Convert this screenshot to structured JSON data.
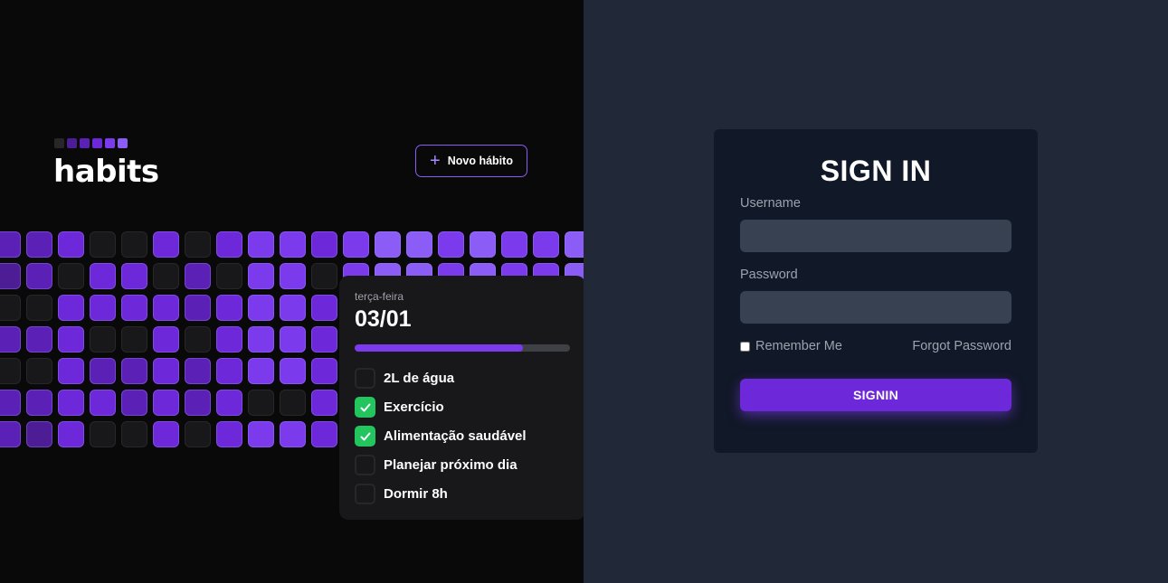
{
  "app": {
    "name": "habits",
    "new_habit_label": "Novo hábito"
  },
  "colors": {
    "accent": "#7c3aed",
    "success": "#22c55e",
    "cell_levels": [
      "#18181b",
      "#4c1d95",
      "#5b21b6",
      "#6d28d9",
      "#7c3aed",
      "#8b5cf6"
    ]
  },
  "heatmap_levels": [
    [
      2,
      2,
      3,
      0,
      0,
      3,
      0,
      3,
      4,
      4,
      3,
      4,
      5,
      5,
      4,
      5,
      4,
      4,
      5
    ],
    [
      1,
      2,
      0,
      3,
      3,
      0,
      2,
      0,
      4,
      4,
      0,
      4,
      5,
      5,
      4,
      5,
      4,
      4,
      5
    ],
    [
      0,
      0,
      3,
      3,
      3,
      3,
      2,
      3,
      4,
      4,
      3,
      4,
      5,
      4,
      4,
      5,
      4,
      4,
      5
    ],
    [
      2,
      2,
      3,
      0,
      0,
      3,
      0,
      3,
      4,
      4,
      3,
      4,
      5,
      5,
      4,
      5,
      4,
      4,
      5
    ],
    [
      0,
      0,
      3,
      2,
      2,
      3,
      2,
      3,
      4,
      4,
      3,
      4,
      5,
      4,
      4,
      5,
      4,
      4,
      5
    ],
    [
      2,
      2,
      3,
      3,
      2,
      3,
      2,
      3,
      0,
      0,
      3,
      4,
      5,
      5,
      4,
      5,
      4,
      4,
      5
    ],
    [
      2,
      1,
      3,
      0,
      0,
      3,
      0,
      3,
      4,
      4,
      3,
      4,
      5,
      5,
      4,
      5,
      4,
      4,
      5
    ]
  ],
  "popover": {
    "weekday": "terça-feira",
    "date": "03/01",
    "progress": 0.78,
    "tasks": [
      {
        "label": "2L de água",
        "done": false
      },
      {
        "label": "Exercício",
        "done": true
      },
      {
        "label": "Alimentação saudável",
        "done": true
      },
      {
        "label": "Planejar próximo dia",
        "done": false
      },
      {
        "label": "Dormir 8h",
        "done": false
      }
    ]
  },
  "signin": {
    "title": "SIGN IN",
    "username_label": "Username",
    "username_value": "",
    "password_label": "Password",
    "password_value": "",
    "remember_label": "Remember Me",
    "remember_checked": false,
    "forgot_label": "Forgot Password",
    "button_label": "SIGNIN"
  }
}
